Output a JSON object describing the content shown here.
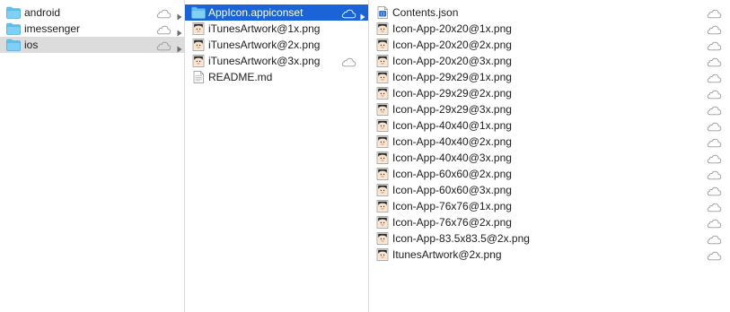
{
  "colors": {
    "selection_active": "#1a64d8",
    "selection_inactive": "#dcdcdc",
    "folder": "#5ec2f2",
    "cloud_outline": "#9a9a9a"
  },
  "columns": [
    {
      "items": [
        {
          "label": "android",
          "icon": "folder-icon",
          "cloud": true,
          "disclosure": true,
          "state": "normal"
        },
        {
          "label": "imessenger",
          "icon": "folder-icon",
          "cloud": true,
          "disclosure": true,
          "state": "normal"
        },
        {
          "label": "ios",
          "icon": "folder-icon",
          "cloud": true,
          "disclosure": true,
          "state": "selected-inactive"
        }
      ]
    },
    {
      "items": [
        {
          "label": "AppIcon.appiconset",
          "icon": "folder-icon",
          "cloud": true,
          "disclosure": true,
          "state": "selected-active"
        },
        {
          "label": "iTunesArtwork@1x.png",
          "icon": "image-thumbnail-icon",
          "cloud": false,
          "disclosure": false,
          "state": "normal"
        },
        {
          "label": "iTunesArtwork@2x.png",
          "icon": "image-thumbnail-icon",
          "cloud": false,
          "disclosure": false,
          "state": "normal"
        },
        {
          "label": "iTunesArtwork@3x.png",
          "icon": "image-thumbnail-icon",
          "cloud": true,
          "disclosure": false,
          "state": "normal"
        },
        {
          "label": "README.md",
          "icon": "text-document-icon",
          "cloud": false,
          "disclosure": false,
          "state": "normal"
        }
      ]
    },
    {
      "items": [
        {
          "label": "Contents.json",
          "icon": "json-document-icon",
          "cloud": true,
          "disclosure": false,
          "state": "normal"
        },
        {
          "label": "Icon-App-20x20@1x.png",
          "icon": "image-thumbnail-icon",
          "cloud": true,
          "disclosure": false,
          "state": "normal"
        },
        {
          "label": "Icon-App-20x20@2x.png",
          "icon": "image-thumbnail-icon",
          "cloud": true,
          "disclosure": false,
          "state": "normal"
        },
        {
          "label": "Icon-App-20x20@3x.png",
          "icon": "image-thumbnail-icon",
          "cloud": true,
          "disclosure": false,
          "state": "normal"
        },
        {
          "label": "Icon-App-29x29@1x.png",
          "icon": "image-thumbnail-icon",
          "cloud": true,
          "disclosure": false,
          "state": "normal"
        },
        {
          "label": "Icon-App-29x29@2x.png",
          "icon": "image-thumbnail-icon",
          "cloud": true,
          "disclosure": false,
          "state": "normal"
        },
        {
          "label": "Icon-App-29x29@3x.png",
          "icon": "image-thumbnail-icon",
          "cloud": true,
          "disclosure": false,
          "state": "normal"
        },
        {
          "label": "Icon-App-40x40@1x.png",
          "icon": "image-thumbnail-icon",
          "cloud": true,
          "disclosure": false,
          "state": "normal"
        },
        {
          "label": "Icon-App-40x40@2x.png",
          "icon": "image-thumbnail-icon",
          "cloud": true,
          "disclosure": false,
          "state": "normal"
        },
        {
          "label": "Icon-App-40x40@3x.png",
          "icon": "image-thumbnail-icon",
          "cloud": true,
          "disclosure": false,
          "state": "normal"
        },
        {
          "label": "Icon-App-60x60@2x.png",
          "icon": "image-thumbnail-icon",
          "cloud": true,
          "disclosure": false,
          "state": "normal"
        },
        {
          "label": "Icon-App-60x60@3x.png",
          "icon": "image-thumbnail-icon",
          "cloud": true,
          "disclosure": false,
          "state": "normal"
        },
        {
          "label": "Icon-App-76x76@1x.png",
          "icon": "image-thumbnail-icon",
          "cloud": true,
          "disclosure": false,
          "state": "normal"
        },
        {
          "label": "Icon-App-76x76@2x.png",
          "icon": "image-thumbnail-icon",
          "cloud": true,
          "disclosure": false,
          "state": "normal"
        },
        {
          "label": "Icon-App-83.5x83.5@2x.png",
          "icon": "image-thumbnail-icon",
          "cloud": true,
          "disclosure": false,
          "state": "normal"
        },
        {
          "label": "ItunesArtwork@2x.png",
          "icon": "image-thumbnail-icon",
          "cloud": true,
          "disclosure": false,
          "state": "normal"
        }
      ]
    }
  ]
}
